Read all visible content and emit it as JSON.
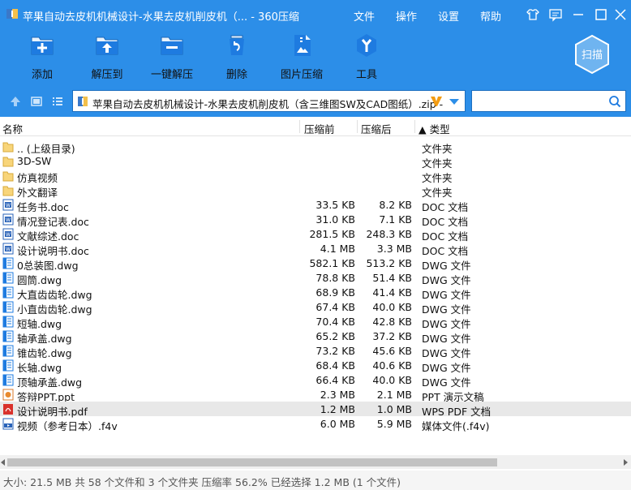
{
  "window": {
    "title": "苹果自动去皮机机械设计-水果去皮机削皮机（... - 360压缩"
  },
  "menu": [
    "文件",
    "操作",
    "设置",
    "帮助"
  ],
  "toolbar": {
    "add": "添加",
    "extract_to": "解压到",
    "one_click_extract": "一键解压",
    "delete": "删除",
    "image_compress": "图片压缩",
    "tools": "工具",
    "scan": "扫描"
  },
  "address": {
    "path": "苹果自动去皮机机械设计-水果去皮机削皮机（含三维图SW及CAD图纸）.zip -",
    "search_placeholder": ""
  },
  "columns": {
    "name": "名称",
    "size": "压缩前",
    "compressed": "压缩后",
    "type": "▲ 类型"
  },
  "files": [
    {
      "icon": "folder-up",
      "name": ".. (上级目录)",
      "size": "",
      "compressed": "",
      "type": "文件夹"
    },
    {
      "icon": "folder",
      "name": "3D-SW",
      "size": "",
      "compressed": "",
      "type": "文件夹"
    },
    {
      "icon": "folder",
      "name": "仿真视频",
      "size": "",
      "compressed": "",
      "type": "文件夹"
    },
    {
      "icon": "folder",
      "name": "外文翻译",
      "size": "",
      "compressed": "",
      "type": "文件夹"
    },
    {
      "icon": "doc",
      "name": "任务书.doc",
      "size": "33.5 KB",
      "compressed": "8.2 KB",
      "type": "DOC 文档"
    },
    {
      "icon": "doc",
      "name": "情况登记表.doc",
      "size": "31.0 KB",
      "compressed": "7.1 KB",
      "type": "DOC 文档"
    },
    {
      "icon": "doc",
      "name": "文献综述.doc",
      "size": "281.5 KB",
      "compressed": "248.3 KB",
      "type": "DOC 文档"
    },
    {
      "icon": "doc",
      "name": "设计说明书.doc",
      "size": "4.1 MB",
      "compressed": "3.3 MB",
      "type": "DOC 文档"
    },
    {
      "icon": "dwg",
      "name": "0总装图.dwg",
      "size": "582.1 KB",
      "compressed": "513.2 KB",
      "type": "DWG 文件"
    },
    {
      "icon": "dwg",
      "name": "圆筒.dwg",
      "size": "78.8 KB",
      "compressed": "51.4 KB",
      "type": "DWG 文件"
    },
    {
      "icon": "dwg",
      "name": "大直齿齿轮.dwg",
      "size": "68.9 KB",
      "compressed": "41.4 KB",
      "type": "DWG 文件"
    },
    {
      "icon": "dwg",
      "name": "小直齿齿轮.dwg",
      "size": "67.4 KB",
      "compressed": "40.0 KB",
      "type": "DWG 文件"
    },
    {
      "icon": "dwg",
      "name": "短轴.dwg",
      "size": "70.4 KB",
      "compressed": "42.8 KB",
      "type": "DWG 文件"
    },
    {
      "icon": "dwg",
      "name": "轴承盖.dwg",
      "size": "65.2 KB",
      "compressed": "37.2 KB",
      "type": "DWG 文件"
    },
    {
      "icon": "dwg",
      "name": "锥齿轮.dwg",
      "size": "73.2 KB",
      "compressed": "45.6 KB",
      "type": "DWG 文件"
    },
    {
      "icon": "dwg",
      "name": "长轴.dwg",
      "size": "68.4 KB",
      "compressed": "40.6 KB",
      "type": "DWG 文件"
    },
    {
      "icon": "dwg",
      "name": "顶轴承盖.dwg",
      "size": "66.4 KB",
      "compressed": "40.0 KB",
      "type": "DWG 文件"
    },
    {
      "icon": "ppt",
      "name": "答辩PPT.ppt",
      "size": "2.3 MB",
      "compressed": "2.1 MB",
      "type": "PPT 演示文稿"
    },
    {
      "icon": "pdf",
      "name": "设计说明书.pdf",
      "size": "1.2 MB",
      "compressed": "1.0 MB",
      "type": "WPS PDF 文档",
      "selected": true
    },
    {
      "icon": "video",
      "name": "视频（参考日本）.f4v",
      "size": "6.0 MB",
      "compressed": "5.9 MB",
      "type": "媒体文件(.f4v)"
    }
  ],
  "status": {
    "text": "大小: 21.5 MB 共 58 个文件和 3 个文件夹 压缩率 56.2% 已经选择 1.2 MB (1 个文件)"
  },
  "colors": {
    "accent": "#2c8ee8",
    "selected_row": "#e8e8e8"
  }
}
